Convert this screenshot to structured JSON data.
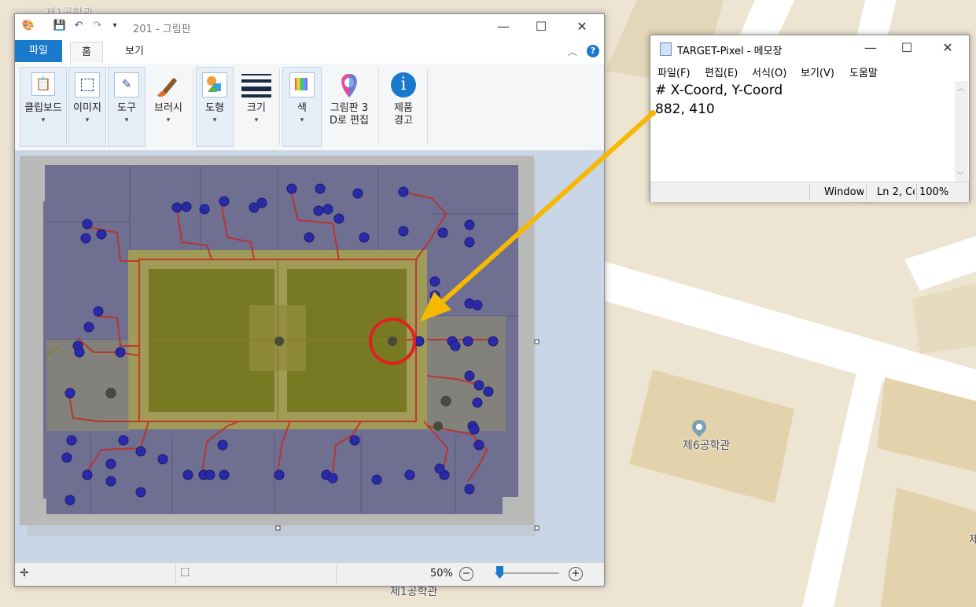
{
  "map": {
    "labels": [
      "제1공학관",
      "제6공학관",
      "제1공학관"
    ],
    "edge_label": "제"
  },
  "paint": {
    "title": "201 - 그림판",
    "tabs": [
      "파일",
      "홈",
      "보기"
    ],
    "groups": {
      "clipboard": "클립보드",
      "image": "이미지",
      "tools": "도구",
      "brushes": "브러시",
      "shapes": "도형",
      "size": "크기",
      "color": "색",
      "paint3d_line1": "그림판 3",
      "paint3d_line2": "D로 편집",
      "product_line1": "제품",
      "product_line2": "경고"
    },
    "status": {
      "zoom": "50%",
      "zoom_level": 0.5
    },
    "colors": {
      "accent": "#1979ca",
      "marker_circle": "#e02020",
      "arrow": "#f6b800"
    }
  },
  "notepad": {
    "title": "TARGET-Pixel - 메모장",
    "menu": [
      "파일(F)",
      "편집(E)",
      "서식(O)",
      "보기(V)",
      "도움말"
    ],
    "lines": [
      "# X-Coord, Y-Coord",
      "882, 410"
    ],
    "status": {
      "encoding": "Window",
      "position": "Ln 2, Co",
      "zoom": "100%"
    }
  }
}
